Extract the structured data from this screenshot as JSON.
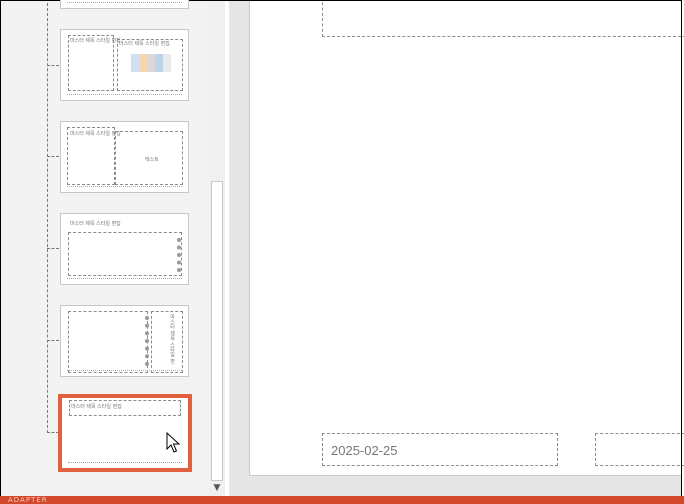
{
  "thumbnails": [
    {
      "title": ""
    },
    {
      "title": "마스터 제목 스타일 편집",
      "content_title": "마스터 제목 스타일 편집"
    },
    {
      "title": "마스터 제목 스타일 편집",
      "content_text": "텍스트"
    },
    {
      "title": "마스터 제목 스타일 편집"
    },
    {
      "title": "마스터 제목 스타일 편집",
      "vertical_text": "마스터 제목 스타일 편"
    },
    {
      "title": "마스터 제목 스타일 편집",
      "selected": true
    }
  ],
  "slide": {
    "date": "2025-02-25"
  },
  "statusbar": {
    "text": "ADAPTER"
  },
  "colors": {
    "selection": "#e0603f",
    "statusbar": "#d2492b"
  }
}
